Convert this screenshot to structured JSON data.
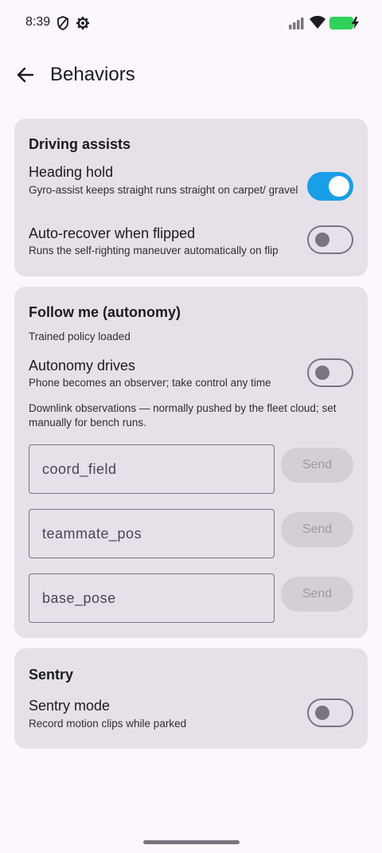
{
  "status_bar": {
    "time": "8:39"
  },
  "app_bar": {
    "title": "Behaviors"
  },
  "driving_assists": {
    "title": "Driving assists",
    "heading_hold": {
      "title": "Heading hold",
      "subtitle": "Gyro-assist keeps straight runs straight on carpet/ gravel",
      "enabled": true
    },
    "auto_recover": {
      "title": "Auto-recover when flipped",
      "subtitle": "Runs the self-righting maneuver automatically on flip",
      "enabled": false
    }
  },
  "follow_me": {
    "title": "Follow me (autonomy)",
    "status": "Trained policy loaded",
    "autonomy_drives": {
      "title": "Autonomy drives",
      "subtitle": "Phone becomes an observer; take control any time",
      "enabled": false
    },
    "downlink_note": "Downlink observations — normally pushed by the fleet cloud; set manually for bench runs.",
    "fields": [
      {
        "placeholder": "coord_field",
        "button": "Send"
      },
      {
        "placeholder": "teammate_pos",
        "button": "Send"
      },
      {
        "placeholder": "base_pose",
        "button": "Send"
      }
    ]
  },
  "sentry": {
    "title": "Sentry",
    "sentry_mode": {
      "title": "Sentry mode",
      "subtitle": "Record motion clips while parked",
      "enabled": false
    }
  },
  "colors": {
    "accent": "#1a9ee6",
    "card_bg": "#e6e1e8",
    "page_bg": "#fcf7fd",
    "battery": "#2fd158"
  }
}
